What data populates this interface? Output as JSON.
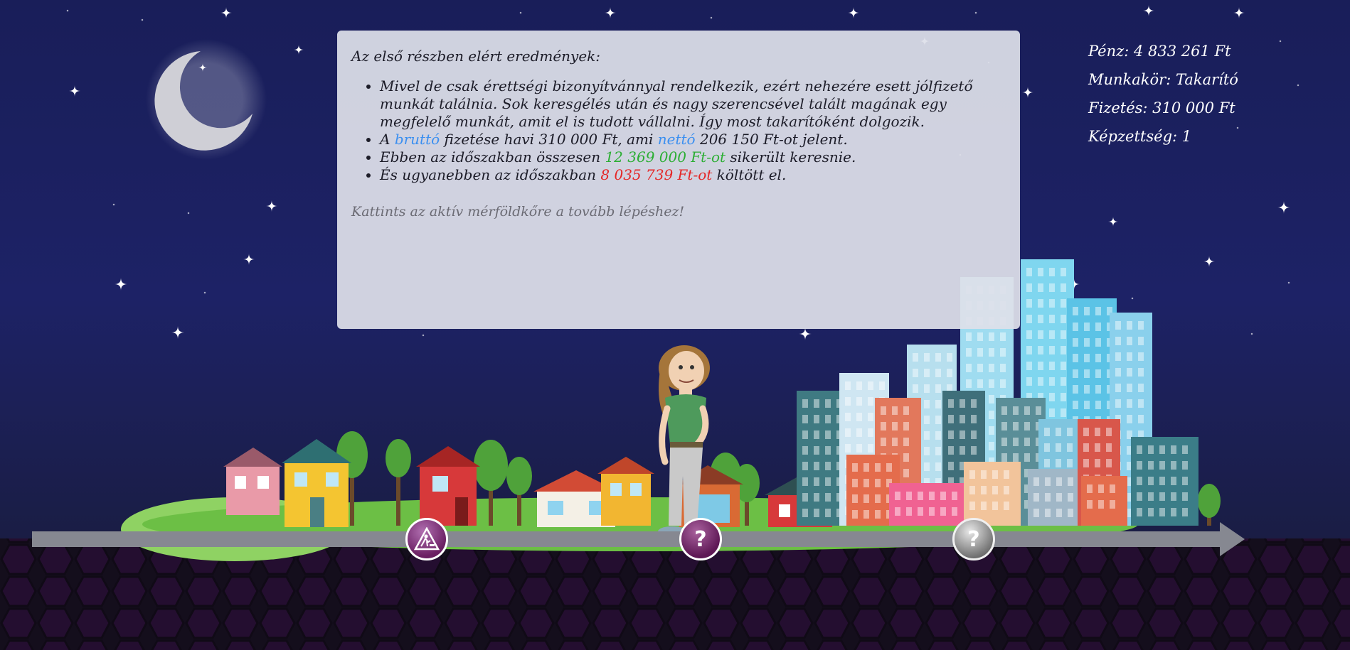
{
  "panel": {
    "heading": "Az első részben elért eredmények:",
    "bullets": [
      {
        "parts": [
          {
            "text": "Mivel de csak érettségi bizonyítvánnyal rendelkezik, ezért nehezére esett jólfizető munkát találnia. Sok keresgélés után és nagy szerencsével talált magának egy megfelelő munkát, amit el is tudott vállalni. Így most takarítóként dolgozik."
          }
        ]
      },
      {
        "parts": [
          {
            "text": "A "
          },
          {
            "text": "bruttó",
            "color": "blue"
          },
          {
            "text": " fizetése havi 310 000 Ft, ami "
          },
          {
            "text": "nettó",
            "color": "blue"
          },
          {
            "text": " 206 150 Ft-ot jelent."
          }
        ]
      },
      {
        "parts": [
          {
            "text": "Ebben az időszakban összesen "
          },
          {
            "text": "12 369 000 Ft-ot",
            "color": "green"
          },
          {
            "text": " sikerült keresnie."
          }
        ]
      },
      {
        "parts": [
          {
            "text": "És ugyanebben az időszakban "
          },
          {
            "text": "8 035 739 Ft-ot",
            "color": "red"
          },
          {
            "text": " költött el."
          }
        ]
      }
    ],
    "hint": "Kattints az aktív mérföldkőre a tovább lépéshez!"
  },
  "stats": {
    "money": "Pénz: 4 833 261 Ft",
    "job": "Munkakör: Takarító",
    "salary": "Fizetés: 310 000 Ft",
    "education": "Képzettség: 1"
  },
  "milestones": [
    {
      "name": "milestone-current",
      "icon": "construction-worker-icon",
      "state": "active"
    },
    {
      "name": "milestone-next",
      "label": "?",
      "state": "next"
    },
    {
      "name": "milestone-locked",
      "label": "?",
      "state": "locked"
    }
  ],
  "colors": {
    "sky_top": "#191e59",
    "ground": "#111118",
    "hex_purple": "#3a1348",
    "accent_blue": "#3b8ff0",
    "accent_green": "#2cae34",
    "accent_red": "#e52626",
    "milestone_purple": "#6b1f63"
  }
}
